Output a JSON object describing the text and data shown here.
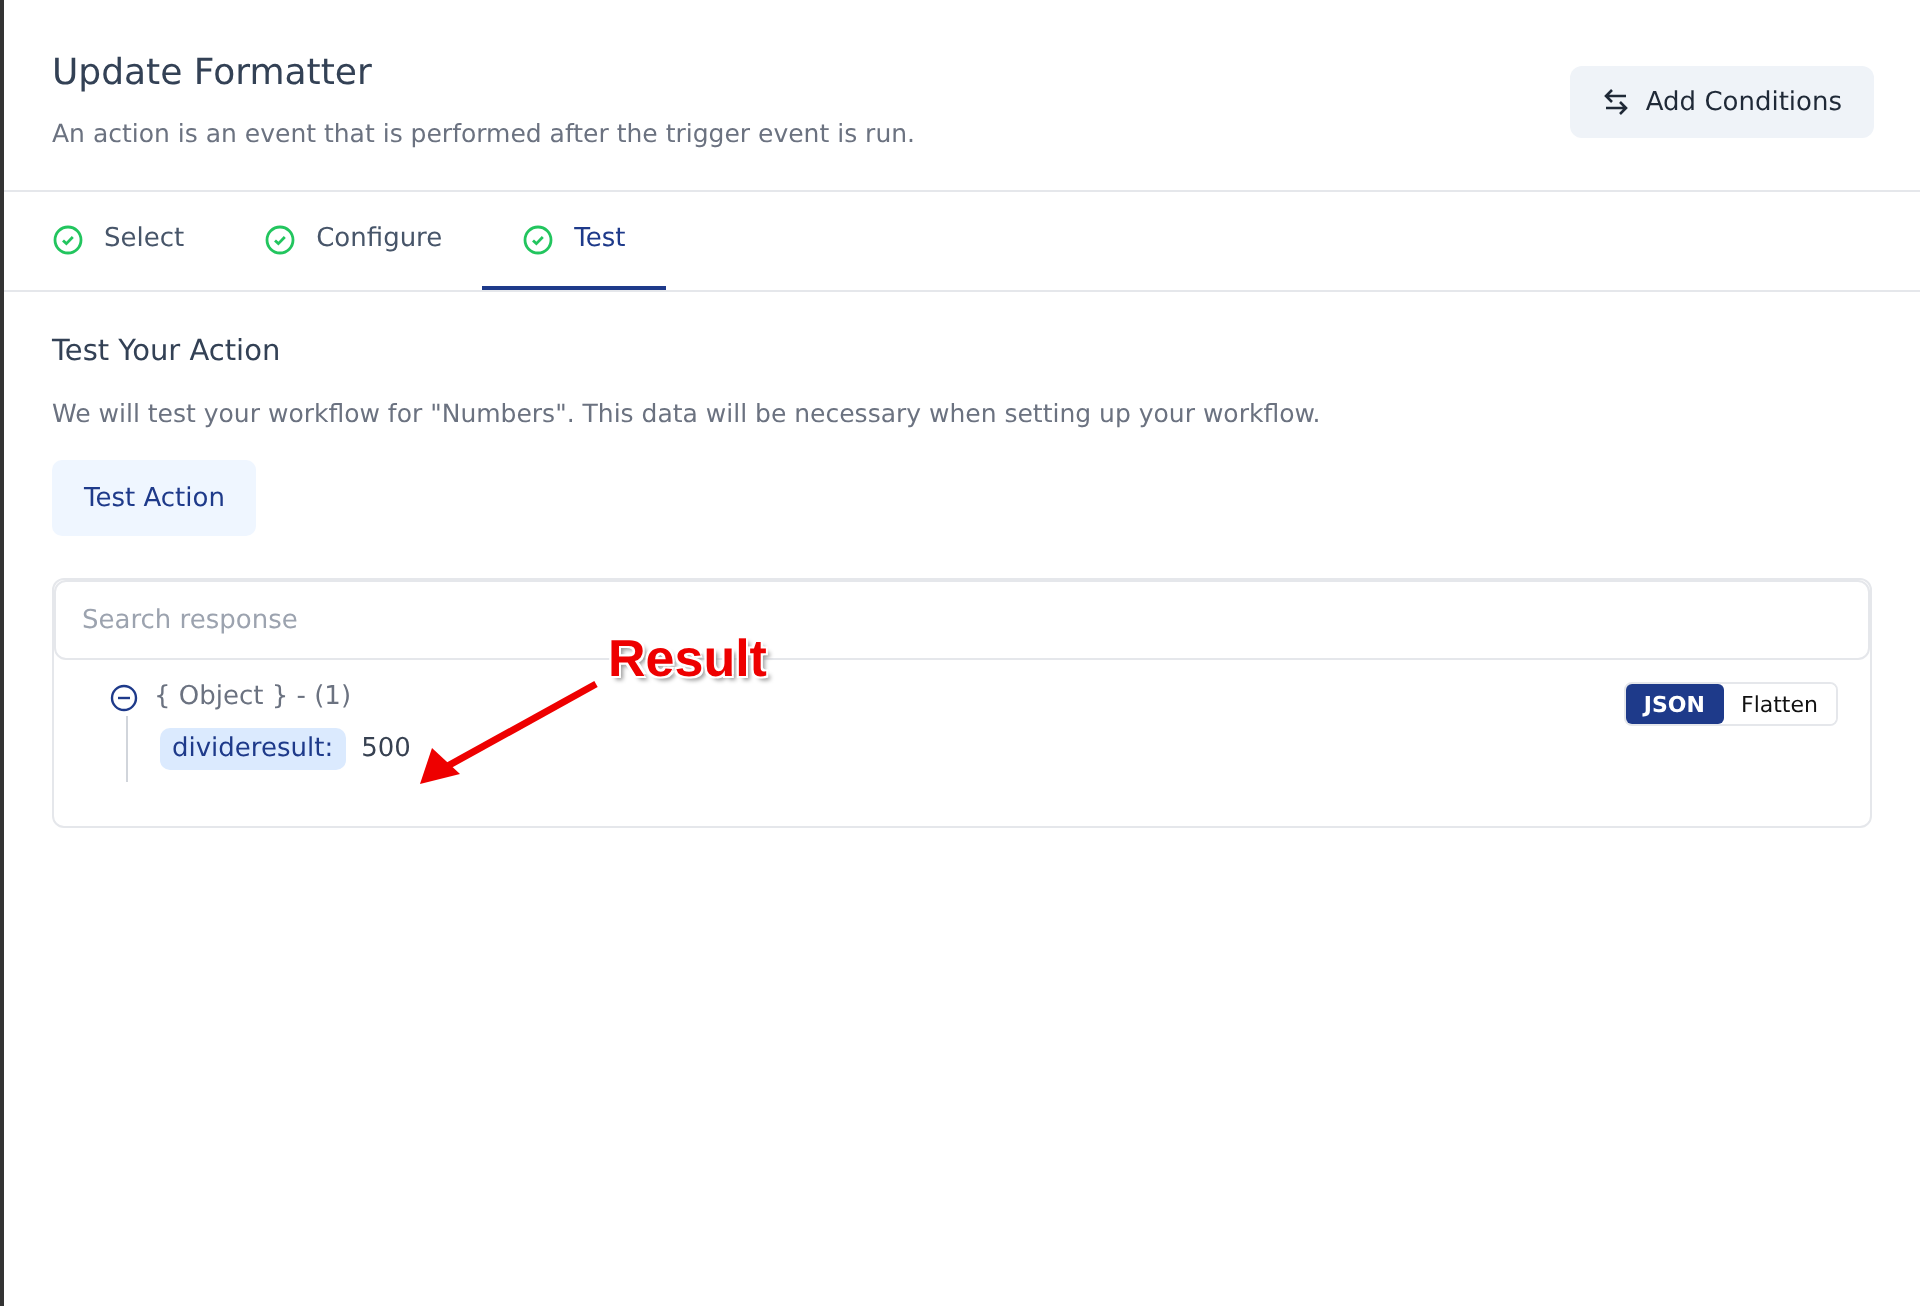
{
  "header": {
    "title": "Update Formatter",
    "subtitle": "An action is an event that is performed after the trigger event is run.",
    "button": "Add Conditions"
  },
  "tabs": [
    {
      "label": "Select",
      "selected": false,
      "done": true
    },
    {
      "label": "Configure",
      "selected": false,
      "done": true
    },
    {
      "label": "Test",
      "selected": true,
      "done": true
    }
  ],
  "section": {
    "title": "Test Your Action",
    "description": "We will test your workflow for \"Numbers\". This data will be necessary when setting up your workflow.",
    "button": "Test Action"
  },
  "response": {
    "search": {
      "placeholder": "Search response"
    },
    "views": [
      {
        "label": "JSON",
        "selected": true
      },
      {
        "label": "Flatten",
        "selected": false
      }
    ],
    "tree": {
      "label": "{ Object } - (1)",
      "expanded": true,
      "children": [
        {
          "key": "divideresult:",
          "value": "500"
        }
      ]
    }
  },
  "annotation": {
    "text": "Result"
  }
}
